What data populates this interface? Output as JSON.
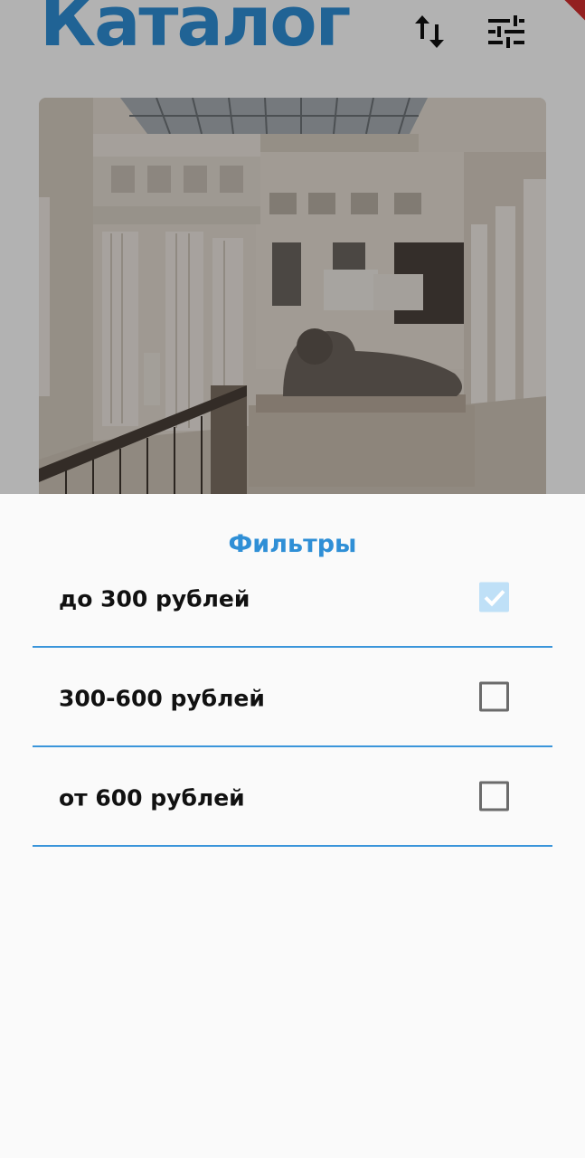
{
  "header": {
    "title": "Каталог",
    "sort_icon": "swap-vert-icon",
    "filter_icon": "tune-icon"
  },
  "catalog": {
    "image_subject": "museum-hall-photo"
  },
  "filters": {
    "title": "Фильтры",
    "options": [
      {
        "label": "до 300 рублей",
        "checked": true
      },
      {
        "label": "300-600 рублей",
        "checked": false
      },
      {
        "label": "от 600 рублей",
        "checked": false
      }
    ]
  },
  "colors": {
    "accent": "#2f8fd6",
    "divider": "#3a95da",
    "checked_fill": "#bfe0f7",
    "debug_banner": "#d32f2f"
  }
}
